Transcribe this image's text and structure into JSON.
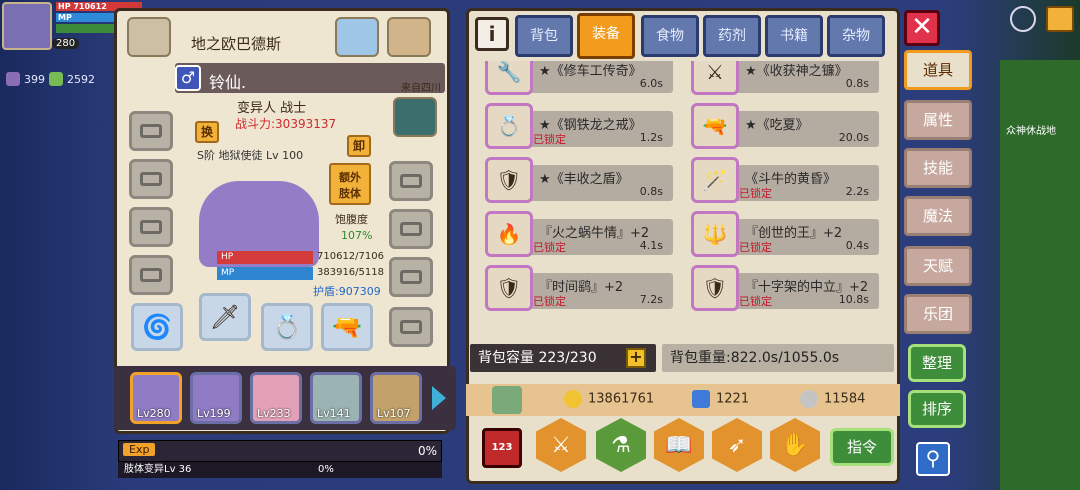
{
  "hud": {
    "hp_label": "HP",
    "hp_value": "710612",
    "mp_label": "MP",
    "level_badge": "280",
    "res1": "399",
    "res2": "2592"
  },
  "left": {
    "title": "地之欧巴德斯",
    "name": "铃仙.",
    "origin": "来自四川",
    "class": "变异人 战士",
    "power": "战斗力:30393137",
    "swap": "换",
    "unequip": "卸",
    "extra_limb": "额外\n肢体",
    "rank": "S阶 地狱使徒 Lv 100",
    "satiety_label": "饱腹度",
    "satiety_value": "107%",
    "hp_label": "HP",
    "hp_value": "710612/7106",
    "mp_label": "MP",
    "mp_value": "383916/5118",
    "shield": "护盾:907309",
    "party": [
      {
        "lv": "Lv280"
      },
      {
        "lv": "Lv199"
      },
      {
        "lv": "Lv233"
      },
      {
        "lv": "Lv141"
      },
      {
        "lv": "Lv107"
      }
    ],
    "exp_label": "Exp",
    "exp_pct": "0%",
    "limb_label": "肢体变异Lv 36",
    "limb_pct": "0%"
  },
  "tabs": [
    "背包",
    "装备",
    "食物",
    "药剂",
    "书籍",
    "杂物"
  ],
  "active_tab": 1,
  "items": [
    {
      "title": "★《修车工传奇》",
      "locked": "",
      "value": "6.0s"
    },
    {
      "title": "★《收获神之镰》",
      "locked": "",
      "value": "0.8s"
    },
    {
      "title": "★《钢铁龙之戒》",
      "locked": "已锁定",
      "value": "1.2s"
    },
    {
      "title": "★《吃夏》",
      "locked": "",
      "value": "20.0s"
    },
    {
      "title": "★《丰收之盾》",
      "locked": "",
      "value": "0.8s"
    },
    {
      "title": "《斗牛的黄昏》",
      "locked": "已锁定",
      "value": "2.2s"
    },
    {
      "title": "『火之蜗牛情』+2",
      "locked": "已锁定",
      "value": "4.1s"
    },
    {
      "title": "『创世的王』+2",
      "locked": "已锁定",
      "value": "0.4s"
    },
    {
      "title": "『时间鹞』+2",
      "locked": "已锁定",
      "value": "7.2s"
    },
    {
      "title": "『十字架的中立』+2",
      "locked": "已锁定",
      "value": "10.8s"
    }
  ],
  "bag": {
    "capacity": "背包容量 223/230",
    "weight": "背包重量:822.0s/1055.0s"
  },
  "currency": {
    "gold": "13861761",
    "gems": "1221",
    "silver": "11584"
  },
  "side": [
    "道具",
    "属性",
    "技能",
    "魔法",
    "天赋",
    "乐团"
  ],
  "side_active": 0,
  "buttons": {
    "sort1": "整理",
    "sort2": "排序",
    "command": "指令",
    "rank_icon": "123"
  },
  "map": {
    "label": "众神休战地"
  },
  "colors": {
    "accent": "#f39b1c",
    "tab": "#6379ad",
    "locked": "#c0182a"
  }
}
